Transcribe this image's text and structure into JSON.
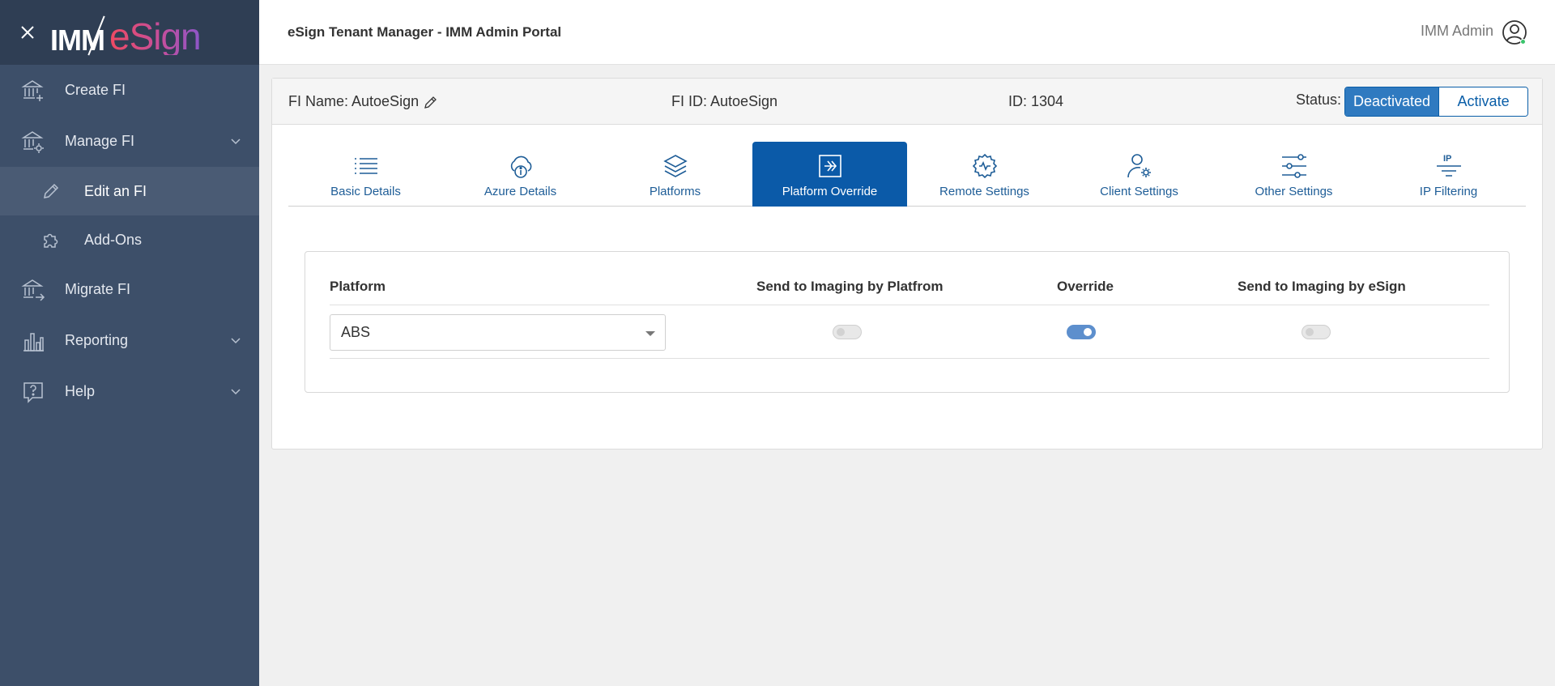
{
  "brand": {
    "logo_prefix": "IMM",
    "logo_suffix": "eSign"
  },
  "header": {
    "title": "eSign Tenant Manager - IMM Admin Portal",
    "user_name": "IMM Admin"
  },
  "sidebar": {
    "items": [
      {
        "label": "Create FI"
      },
      {
        "label": "Manage FI"
      },
      {
        "label": "Edit an FI"
      },
      {
        "label": "Add-Ons"
      },
      {
        "label": "Migrate FI"
      },
      {
        "label": "Reporting"
      },
      {
        "label": "Help"
      }
    ]
  },
  "info": {
    "fi_name": "FI Name: AutoeSign",
    "fi_id": "FI ID: AutoeSign",
    "id": "ID: 1304",
    "status_label": "Status:",
    "status_selected": "Deactivated",
    "status_other": "Activate"
  },
  "tabs": [
    {
      "label": "Basic Details",
      "icon": "list-icon"
    },
    {
      "label": "Azure Details",
      "icon": "cloud-info-icon"
    },
    {
      "label": "Platforms",
      "icon": "layers-icon"
    },
    {
      "label": "Platform Override",
      "icon": "override-arrow-icon",
      "active": true
    },
    {
      "label": "Remote Settings",
      "icon": "remote-gear-icon"
    },
    {
      "label": "Client Settings",
      "icon": "user-gear-icon"
    },
    {
      "label": "Other Settings",
      "icon": "sliders-icon"
    },
    {
      "label": "IP Filtering",
      "icon": "ip-filter-icon"
    }
  ],
  "override_table": {
    "columns": [
      "Platform",
      "Send to Imaging by Platfrom",
      "Override",
      "Send to Imaging by eSign"
    ],
    "rows": [
      {
        "platform": "ABS",
        "send_by_platform": false,
        "override": true,
        "send_by_esign": false
      }
    ]
  },
  "colors": {
    "sidebar": "#3d4f69",
    "accent": "#0b5aa8",
    "toggle_on": "#5d8fcd"
  }
}
